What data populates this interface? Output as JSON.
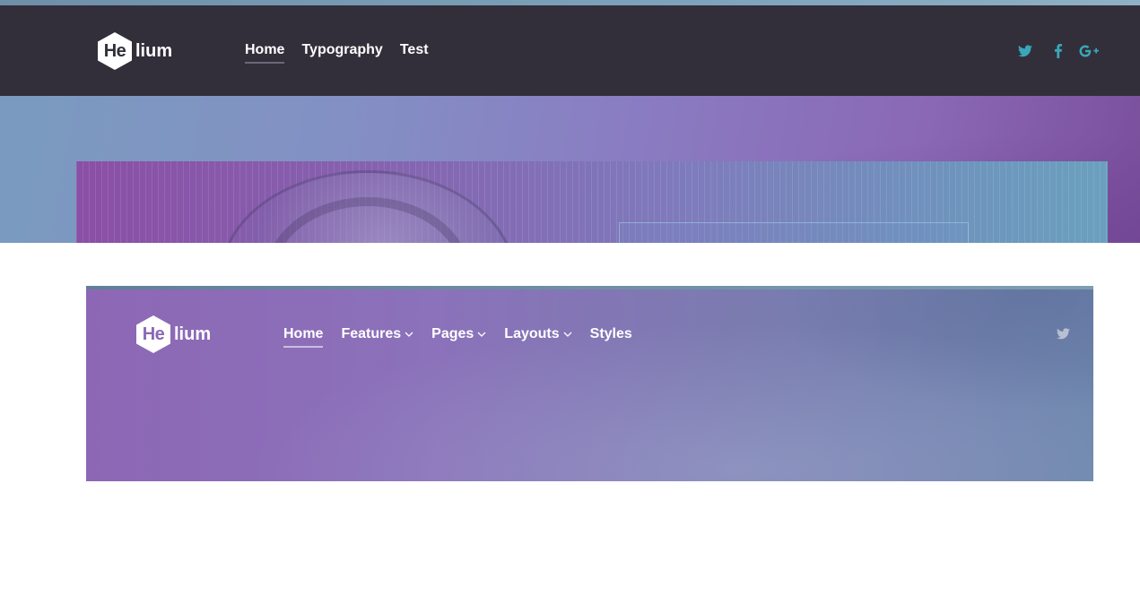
{
  "colors": {
    "header_dark": "#322f3a",
    "social_teal": "#3aa6b9",
    "nav_text": "#ffffff",
    "purple_accent": "#8a68b6",
    "muted_social": "#b8bfd2"
  },
  "top_demo": {
    "logo": {
      "mark": "He",
      "rest": "lium"
    },
    "nav": [
      {
        "label": "Home",
        "active": true
      },
      {
        "label": "Typography",
        "active": false
      },
      {
        "label": "Test",
        "active": false
      }
    ],
    "social": [
      {
        "name": "twitter-icon"
      },
      {
        "name": "facebook-icon"
      },
      {
        "name": "google-plus-icon"
      }
    ]
  },
  "bottom_demo": {
    "logo": {
      "mark": "He",
      "rest": "lium"
    },
    "nav": [
      {
        "label": "Home",
        "active": true,
        "dropdown": false
      },
      {
        "label": "Features",
        "active": false,
        "dropdown": true
      },
      {
        "label": "Pages",
        "active": false,
        "dropdown": true
      },
      {
        "label": "Layouts",
        "active": false,
        "dropdown": true
      },
      {
        "label": "Styles",
        "active": false,
        "dropdown": false
      }
    ],
    "social": [
      {
        "name": "twitter-icon"
      }
    ]
  }
}
